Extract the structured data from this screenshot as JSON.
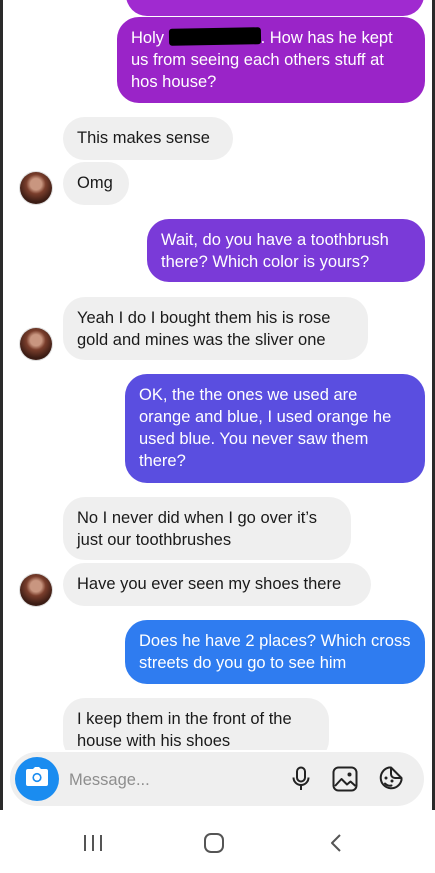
{
  "messages": [
    {
      "side": "out",
      "text": ""
    },
    {
      "side": "out",
      "pre": "Holy ",
      "post": ". How has he kept us from seeing each others stuff at hos house?"
    },
    {
      "side": "in",
      "text": "This makes sense"
    },
    {
      "side": "in",
      "text": "Omg"
    },
    {
      "side": "out",
      "text": "Wait, do you have a toothbrush there? Which color is yours?"
    },
    {
      "side": "in",
      "text": "Yeah I do I bought them his is rose gold and mines was the sliver one"
    },
    {
      "side": "out",
      "text": "OK, the the ones we used are orange and blue, I used orange he used blue. You never saw them there?"
    },
    {
      "side": "in",
      "text": "No I never did when I go over it’s just our toothbrushes"
    },
    {
      "side": "in",
      "text": "Have you ever seen my shoes there"
    },
    {
      "side": "out",
      "text": "Does he have 2 places? Which cross streets do you go to see him"
    },
    {
      "side": "in",
      "text": "I keep them in the front of the house with his shoes"
    }
  ],
  "composer": {
    "placeholder": "Message...",
    "icons": [
      "camera-icon",
      "microphone-icon",
      "gallery-icon",
      "sticker-icon"
    ]
  },
  "navbar": {
    "icons": [
      "recent-apps-icon",
      "home-icon",
      "back-icon"
    ]
  },
  "colors": {
    "incoming_bg": "#efefef",
    "outgoing_purple": "#9a24c8",
    "outgoing_indigo": "#5a4ee0",
    "outgoing_blue": "#2f7cf0",
    "accent": "#1a8cf0"
  }
}
